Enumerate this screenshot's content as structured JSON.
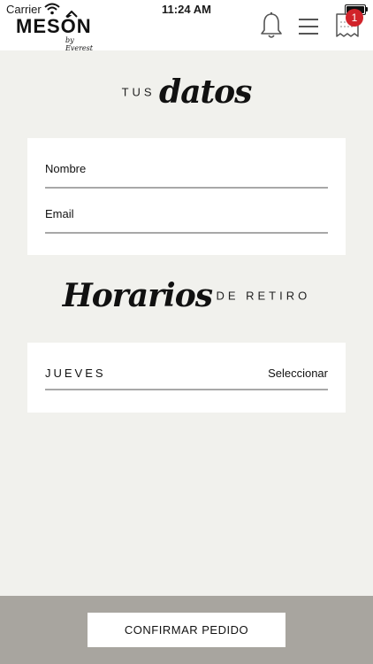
{
  "status_bar": {
    "carrier": "Carrier",
    "time": "11:24 AM"
  },
  "header": {
    "logo_text": "MESÓN",
    "logo_subtext": "by Everest",
    "cart_count": "1",
    "icons": [
      "bell-icon",
      "menu-icon",
      "receipt-icon"
    ],
    "badge_color": "#d1232a"
  },
  "datos": {
    "title_small": "TUS",
    "title_script": "datos",
    "fields": [
      {
        "label": "Nombre",
        "value": ""
      },
      {
        "label": "Email",
        "value": ""
      }
    ]
  },
  "horarios": {
    "title_script": "Horarios",
    "title_small": "DE RETIRO",
    "day": "JUEVES",
    "select_label": "Seleccionar"
  },
  "footer": {
    "confirm_label": "CONFIRMAR PEDIDO"
  },
  "colors": {
    "background": "#f1f1ed",
    "footer": "#a8a59f",
    "field_line": "#a8a8a8"
  }
}
